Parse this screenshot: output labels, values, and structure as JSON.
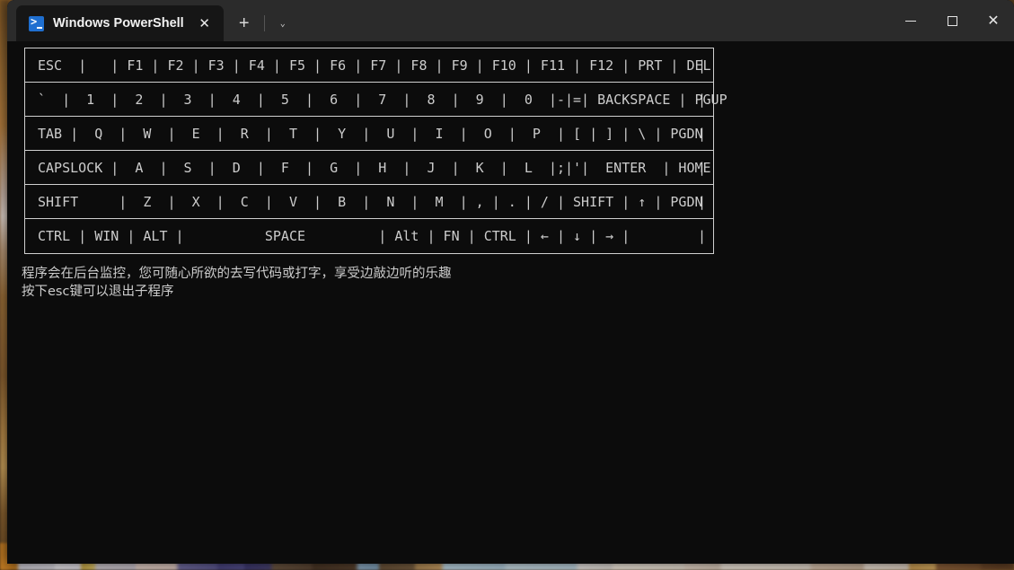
{
  "window": {
    "tab_title": "Windows PowerShell",
    "app_icon": "powershell-icon",
    "close_tab_glyph": "✕",
    "new_tab_glyph": "+",
    "dropdown_glyph": "⌄",
    "minimize_glyph": "",
    "maximize_glyph": "",
    "close_glyph": "✕"
  },
  "keyboard": {
    "rows": [
      {
        "name": "function-row",
        "text": "ESC  |   | F1 | F2 | F3 | F4 | F5 | F6 | F7 | F8 | F9 | F10 | F11 | F12 | PRT | DEL"
      },
      {
        "name": "number-row",
        "text": "`  |  1  |  2  |  3  |  4  |  5  |  6  |  7  |  8  |  9  |  0  |-|=| BACKSPACE | PGUP"
      },
      {
        "name": "qwerty-row",
        "text": "TAB |  Q  |  W  |  E  |  R  |  T  |  Y  |  U  |  I  |  O  |  P  | [ | ] | \\ | PGDN"
      },
      {
        "name": "home-row",
        "text": "CAPSLOCK |  A  |  S  |  D  |  F  |  G  |  H  |  J  |  K  |  L  |;|'|  ENTER  | HOME"
      },
      {
        "name": "shift-row",
        "text": "SHIFT     |  Z  |  X  |  C  |  V  |  B  |  N  |  M  | , | . | / | SHIFT | ↑ | PGDN"
      },
      {
        "name": "modifier-row",
        "text": "CTRL | WIN | ALT |          SPACE         | Alt | FN | CTRL | ← | ↓ | → |"
      }
    ],
    "tail_pipe": "|"
  },
  "messages": {
    "line1": "程序会在后台监控，您可随心所欲的去写代码或打字，享受边敲边听的乐趣",
    "line2": "按下esc键可以退出子程序"
  },
  "colors": {
    "console_bg": "#0c0c0c",
    "titlebar_bg": "#2b2b2b",
    "tab_bg": "#161616",
    "text": "#cccccc",
    "border": "#cfcfcf",
    "accent": "#1f6fd0"
  }
}
